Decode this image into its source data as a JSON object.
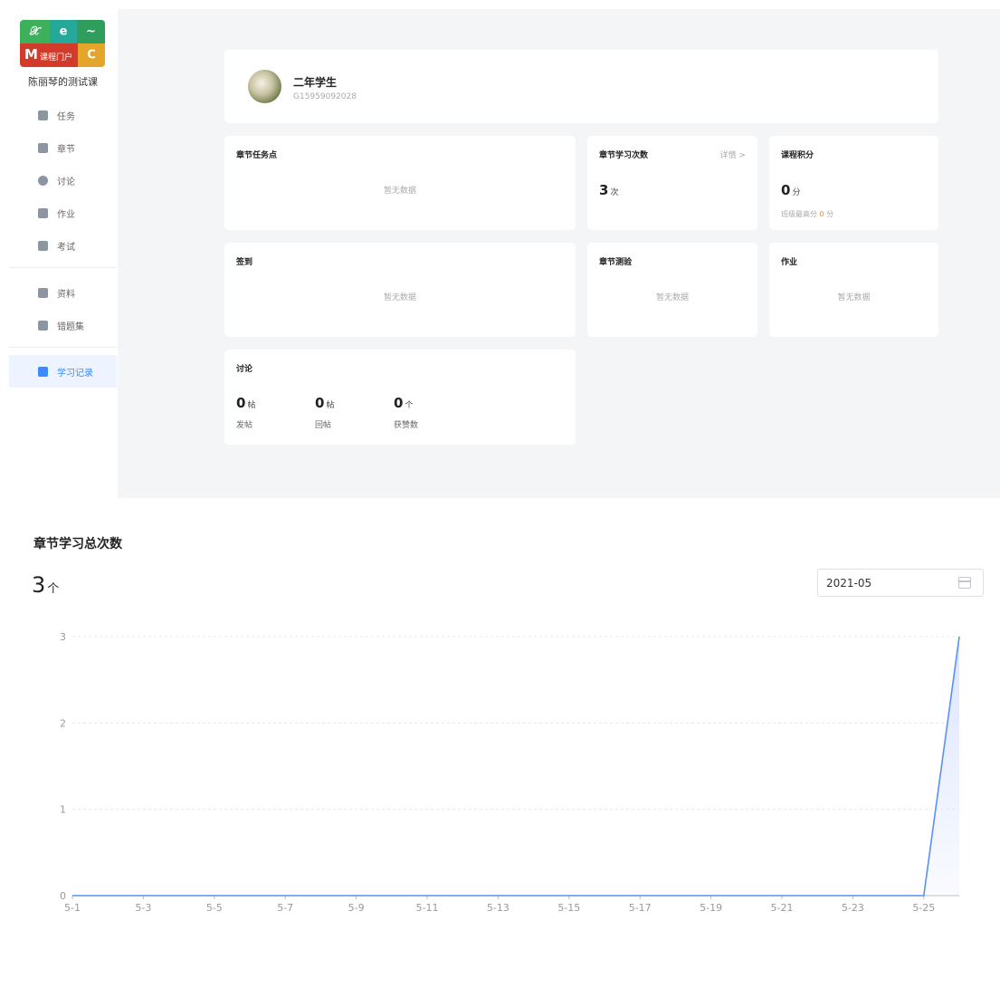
{
  "sidebar": {
    "logo_text": "课程门户",
    "logo_glyphs": [
      "𝒳",
      "e",
      "~",
      "M",
      "C"
    ],
    "course_name": "陈丽琴的测试课",
    "items": [
      {
        "label": "任务",
        "icon": "grid-icon"
      },
      {
        "label": "章节",
        "icon": "list-icon"
      },
      {
        "label": "讨论",
        "icon": "chat-icon"
      },
      {
        "label": "作业",
        "icon": "pencil-icon"
      },
      {
        "label": "考试",
        "icon": "exam-icon"
      },
      {
        "label": "资料",
        "icon": "folder-icon"
      },
      {
        "label": "错题集",
        "icon": "error-book-icon"
      },
      {
        "label": "学习记录",
        "icon": "record-icon",
        "active": true
      }
    ],
    "colors": {
      "active": "#3a8bff",
      "active_bg": "#edf4ff"
    }
  },
  "profile": {
    "name": "二年学生",
    "id": "G15959092028"
  },
  "cards": {
    "chapter_tasks": {
      "title": "章节任务点",
      "empty": "暂无数据"
    },
    "chapter_study": {
      "title": "章节学习次数",
      "link": "详情 >",
      "value": "3",
      "unit": "次"
    },
    "course_points": {
      "title": "课程积分",
      "value": "0",
      "unit": "分",
      "note_prefix": "班级最高分 ",
      "note_value": "0",
      "note_suffix": " 分"
    },
    "checkin": {
      "title": "签到",
      "empty": "暂无数据"
    },
    "chapter_quiz": {
      "title": "章节测验",
      "empty": "暂无数据"
    },
    "homework": {
      "title": "作业",
      "empty": "暂无数据"
    },
    "discussion": {
      "title": "讨论",
      "stats": [
        {
          "value": "0",
          "unit": "帖",
          "label": "发帖"
        },
        {
          "value": "0",
          "unit": "帖",
          "label": "回帖"
        },
        {
          "value": "0",
          "unit": "个",
          "label": "获赞数"
        }
      ]
    }
  },
  "chart_section": {
    "title": "章节学习总次数",
    "total": "3",
    "total_unit": "个",
    "date": "2021-05"
  },
  "chart_data": {
    "type": "area",
    "x": [
      "5-1",
      "5-2",
      "5-3",
      "5-4",
      "5-5",
      "5-6",
      "5-7",
      "5-8",
      "5-9",
      "5-10",
      "5-11",
      "5-12",
      "5-13",
      "5-14",
      "5-15",
      "5-16",
      "5-17",
      "5-18",
      "5-19",
      "5-20",
      "5-21",
      "5-22",
      "5-23",
      "5-24",
      "5-25",
      "5-26"
    ],
    "x_tick_labels": [
      "5-1",
      "5-3",
      "5-5",
      "5-7",
      "5-9",
      "5-11",
      "5-13",
      "5-15",
      "5-17",
      "5-19",
      "5-21",
      "5-23",
      "5-25"
    ],
    "series": [
      {
        "values": [
          0,
          0,
          0,
          0,
          0,
          0,
          0,
          0,
          0,
          0,
          0,
          0,
          0,
          0,
          0,
          0,
          0,
          0,
          0,
          0,
          0,
          0,
          0,
          0,
          0,
          3
        ]
      }
    ],
    "ylim": [
      0,
      3
    ],
    "y_ticks": [
      0,
      1,
      2,
      3
    ],
    "grid": true,
    "line_color": "#5b8ff9",
    "fill_color": "#dbe4ff"
  }
}
